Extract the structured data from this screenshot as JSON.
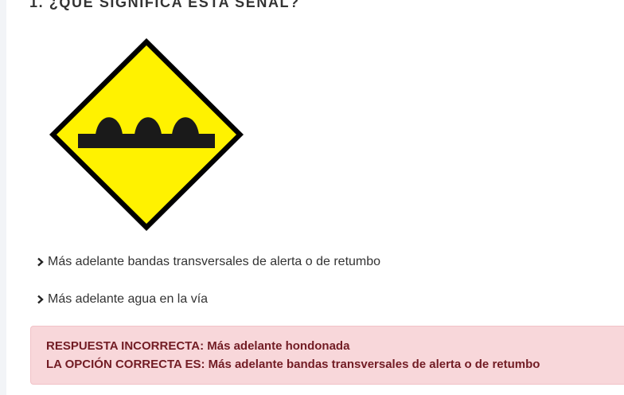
{
  "question": {
    "title": "1. ¿QUÉ SIGNIFICA ESTA SEÑAL?"
  },
  "sign": {
    "icon": "speed-bumps-warning-sign",
    "fill_color": "#fff200",
    "border_color": "#000000"
  },
  "options": [
    {
      "label": "Más adelante bandas transversales de alerta o de retumbo"
    },
    {
      "label": "Más adelante agua en la vía"
    }
  ],
  "feedback": {
    "incorrect_text": "RESPUESTA INCORRECTA: Más adelante hondonada",
    "correct_text": "LA OPCIÓN CORRECTA ES: Más adelante bandas transversales de alerta o de retumbo",
    "background_color": "#f8d7da",
    "text_color": "#721c24"
  }
}
